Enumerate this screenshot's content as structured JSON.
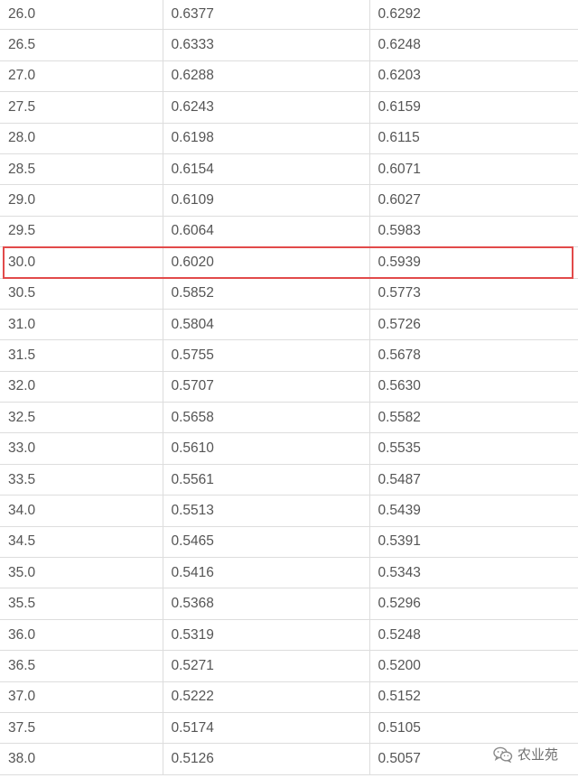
{
  "table": {
    "rows": [
      [
        "26.0",
        "0.6377",
        "0.6292"
      ],
      [
        "26.5",
        "0.6333",
        "0.6248"
      ],
      [
        "27.0",
        "0.6288",
        "0.6203"
      ],
      [
        "27.5",
        "0.6243",
        "0.6159"
      ],
      [
        "28.0",
        "0.6198",
        "0.6115"
      ],
      [
        "28.5",
        "0.6154",
        "0.6071"
      ],
      [
        "29.0",
        "0.6109",
        "0.6027"
      ],
      [
        "29.5",
        "0.6064",
        "0.5983"
      ],
      [
        "30.0",
        "0.6020",
        "0.5939"
      ],
      [
        "30.5",
        "0.5852",
        "0.5773"
      ],
      [
        "31.0",
        "0.5804",
        "0.5726"
      ],
      [
        "31.5",
        "0.5755",
        "0.5678"
      ],
      [
        "32.0",
        "0.5707",
        "0.5630"
      ],
      [
        "32.5",
        "0.5658",
        "0.5582"
      ],
      [
        "33.0",
        "0.5610",
        "0.5535"
      ],
      [
        "33.5",
        "0.5561",
        "0.5487"
      ],
      [
        "34.0",
        "0.5513",
        "0.5439"
      ],
      [
        "34.5",
        "0.5465",
        "0.5391"
      ],
      [
        "35.0",
        "0.5416",
        "0.5343"
      ],
      [
        "35.5",
        "0.5368",
        "0.5296"
      ],
      [
        "36.0",
        "0.5319",
        "0.5248"
      ],
      [
        "36.5",
        "0.5271",
        "0.5200"
      ],
      [
        "37.0",
        "0.5222",
        "0.5152"
      ],
      [
        "37.5",
        "0.5174",
        "0.5105"
      ],
      [
        "38.0",
        "0.5126",
        "0.5057"
      ]
    ],
    "highlighted_row_index": 8,
    "highlight_color": "#e24a4a"
  },
  "watermark": {
    "text": "农业苑",
    "icon": "wechat-icon"
  }
}
